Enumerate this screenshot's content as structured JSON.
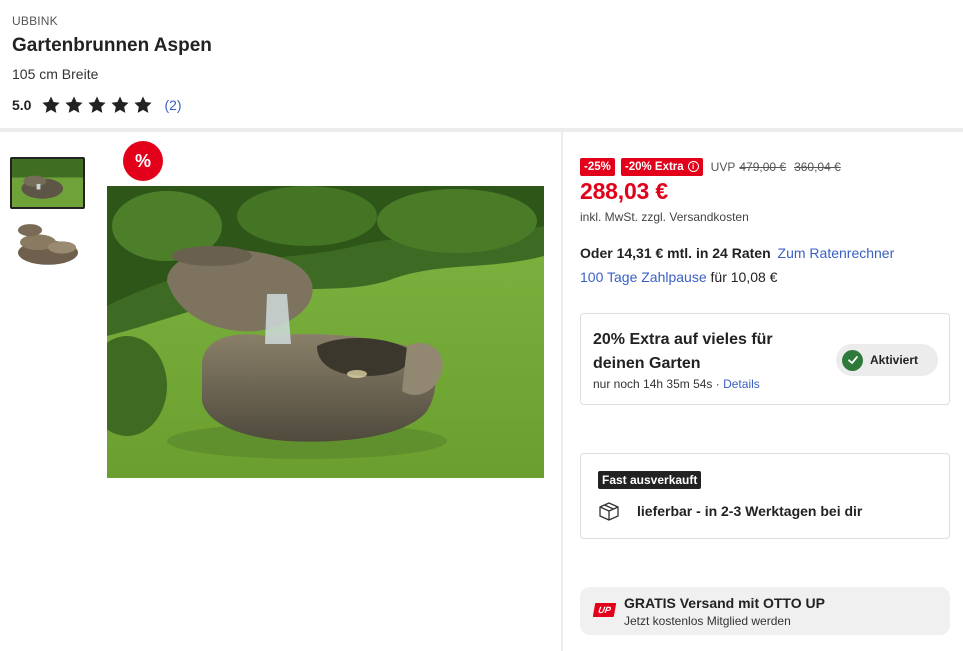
{
  "product": {
    "brand": "UBBINK",
    "title": "Gartenbrunnen Aspen",
    "subtitle": "105 cm Breite",
    "rating_value": "5.0",
    "rating_stars": 5,
    "rating_count": "(2)"
  },
  "gallery": {
    "badge": "%",
    "thumbnail_count": 2,
    "selected_index": 0
  },
  "pricing": {
    "discount_tag": "-25%",
    "extra_tag": "-20% Extra",
    "uvp_label": "UVP",
    "uvp_price": "479,00 €",
    "former_price": "360,04 €",
    "price": "288,03 €",
    "vat_note": "inkl. MwSt. zzgl.",
    "shipping_link": "Versandkosten"
  },
  "financing": {
    "installment_text": "Oder 14,31 € mtl. in 24 Raten",
    "calculator_link": "Zum Ratenrechner",
    "pause_link": "100 Tage Zahlpause",
    "pause_suffix": "für 10,08 €"
  },
  "promo": {
    "title": "20% Extra auf vieles für deinen Garten",
    "countdown": "nur noch 14h 35m 54s ·",
    "details_link": "Details",
    "status": "Aktiviert"
  },
  "availability": {
    "badge": "Fast ausverkauft",
    "delivery": "lieferbar - in 2-3 Werktagen bei dir"
  },
  "otto_up": {
    "logo": "UP",
    "title": "GRATIS Versand mit OTTO UP",
    "subtitle": "Jetzt kostenlos Mitglied werden"
  },
  "colors": {
    "accent_red": "#e2001a",
    "link_blue": "#3b60c4",
    "check_green": "#2d7a3a"
  }
}
